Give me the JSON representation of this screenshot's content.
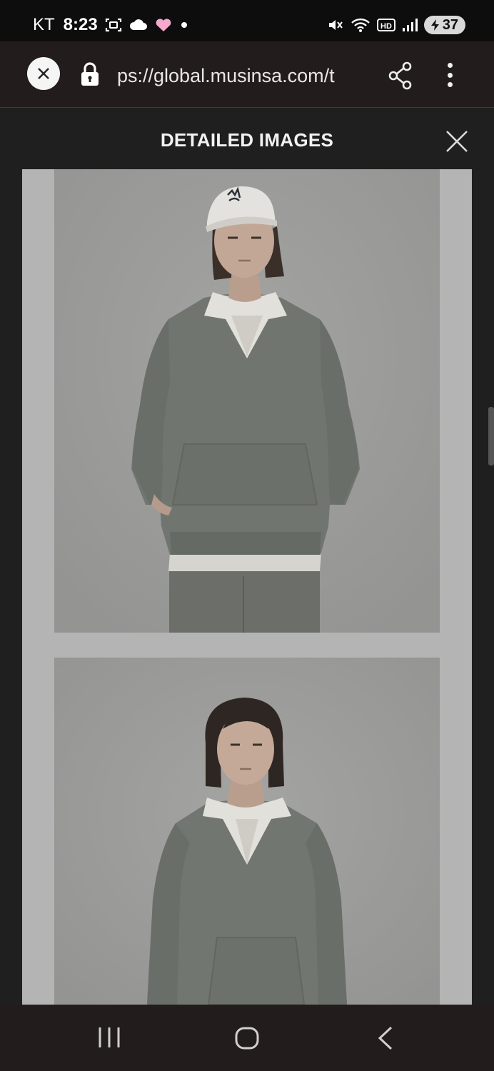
{
  "status_bar": {
    "carrier": "KT",
    "time": "8:23",
    "battery": "37",
    "icons": [
      "screenshot-icon",
      "cloud-icon",
      "heart-icon",
      "dot-icon",
      "mute-icon",
      "wifi-icon",
      "hd-icon",
      "signal-icon",
      "battery-icon"
    ]
  },
  "browser": {
    "url": "ps://global.musinsa.com/t"
  },
  "modal": {
    "title": "DETAILED IMAGES"
  },
  "images": [
    {
      "alt": "Model in white cap wearing grey rugby-collar sweatshirt, hands in pocket"
    },
    {
      "alt": "Model wearing grey rugby-collar sweatshirt"
    }
  ],
  "colors": {
    "status_bg": "#0d0d0d",
    "browser_bg": "#231c1d",
    "modal_bg": "#1f1f20",
    "content_bg": "#b4b4b4",
    "photo_bg": "#9c9c9b",
    "sweatshirt": "#6f746d"
  }
}
